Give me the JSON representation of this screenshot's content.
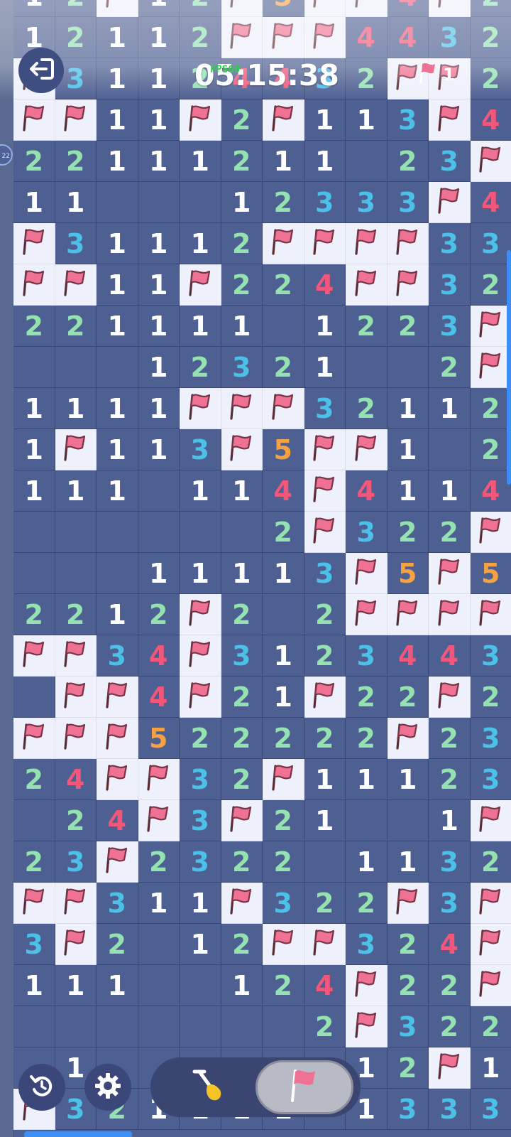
{
  "hud": {
    "timer": "05:15:38",
    "fps_overlay": "FPS60",
    "flags_remaining": "1",
    "side_bubble_text": "22"
  },
  "icons": {
    "exit": "exit-arrow-icon",
    "flag": "flag-icon",
    "undo": "undo-icon",
    "settings": "gear-icon",
    "dig": "shovel-icon"
  },
  "colors": {
    "background": "#4e5f91",
    "flag_cell": "#eef0fb",
    "flag": "#ef7193",
    "n1": "#ffffff",
    "n2": "#93e2b0",
    "n3": "#4bc1ea",
    "n4": "#f0577a",
    "n5": "#f6a142",
    "accent": "#3d8df5"
  },
  "toolbar": {
    "selected_tool": "flag"
  },
  "legend": {
    "F": "flagged cell",
    "0": "revealed empty cell",
    "1-5": "adjacent mine count"
  },
  "board": {
    "columns": 12,
    "rows": [
      [
        "1",
        "2",
        "F",
        "1",
        "2",
        "F",
        "5",
        "F",
        "F",
        "4",
        "F",
        "2"
      ],
      [
        "1",
        "2",
        "1",
        "1",
        "2",
        "F",
        "F",
        "F",
        "4",
        "4",
        "3",
        "2"
      ],
      [
        "F",
        "3",
        "1",
        "1",
        "2",
        "4",
        "4",
        "3",
        "2",
        "F",
        "F",
        "2"
      ],
      [
        "F",
        "F",
        "1",
        "1",
        "F",
        "2",
        "F",
        "1",
        "1",
        "3",
        "F",
        "4"
      ],
      [
        "2",
        "2",
        "1",
        "1",
        "1",
        "2",
        "1",
        "1",
        "0",
        "2",
        "3",
        "F"
      ],
      [
        "1",
        "1",
        "0",
        "0",
        "0",
        "1",
        "2",
        "3",
        "3",
        "3",
        "F",
        "4"
      ],
      [
        "F",
        "3",
        "1",
        "1",
        "1",
        "2",
        "F",
        "F",
        "F",
        "F",
        "3",
        "3"
      ],
      [
        "F",
        "F",
        "1",
        "1",
        "F",
        "2",
        "2",
        "4",
        "F",
        "F",
        "3",
        "2"
      ],
      [
        "2",
        "2",
        "1",
        "1",
        "1",
        "1",
        "0",
        "1",
        "2",
        "2",
        "3",
        "F"
      ],
      [
        "0",
        "0",
        "0",
        "1",
        "2",
        "3",
        "2",
        "1",
        "0",
        "0",
        "2",
        "F"
      ],
      [
        "1",
        "1",
        "1",
        "1",
        "F",
        "F",
        "F",
        "3",
        "2",
        "1",
        "1",
        "2"
      ],
      [
        "1",
        "F",
        "1",
        "1",
        "3",
        "F",
        "5",
        "F",
        "F",
        "1",
        "0",
        "2"
      ],
      [
        "1",
        "1",
        "1",
        "0",
        "1",
        "1",
        "4",
        "F",
        "4",
        "1",
        "1",
        "4"
      ],
      [
        "0",
        "0",
        "0",
        "0",
        "0",
        "0",
        "2",
        "F",
        "3",
        "2",
        "2",
        "F"
      ],
      [
        "0",
        "0",
        "0",
        "1",
        "1",
        "1",
        "1",
        "3",
        "F",
        "5",
        "F",
        "5"
      ],
      [
        "2",
        "2",
        "1",
        "2",
        "F",
        "2",
        "0",
        "2",
        "F",
        "F",
        "F",
        "F"
      ],
      [
        "F",
        "F",
        "3",
        "4",
        "F",
        "3",
        "1",
        "2",
        "3",
        "4",
        "4",
        "3"
      ],
      [
        "0",
        "F",
        "F",
        "4",
        "F",
        "2",
        "1",
        "F",
        "2",
        "2",
        "F",
        "2"
      ],
      [
        "F",
        "F",
        "F",
        "5",
        "2",
        "2",
        "2",
        "2",
        "2",
        "F",
        "2",
        "3"
      ],
      [
        "2",
        "4",
        "F",
        "F",
        "3",
        "2",
        "F",
        "1",
        "1",
        "1",
        "2",
        "3"
      ],
      [
        "0",
        "2",
        "4",
        "F",
        "3",
        "F",
        "2",
        "1",
        "0",
        "0",
        "1",
        "F"
      ],
      [
        "2",
        "3",
        "F",
        "2",
        "3",
        "2",
        "2",
        "0",
        "1",
        "1",
        "3",
        "2"
      ],
      [
        "F",
        "F",
        "3",
        "1",
        "1",
        "F",
        "3",
        "2",
        "2",
        "F",
        "3",
        "F"
      ],
      [
        "3",
        "F",
        "2",
        "0",
        "1",
        "2",
        "F",
        "F",
        "3",
        "2",
        "4",
        "F"
      ],
      [
        "1",
        "1",
        "1",
        "0",
        "0",
        "1",
        "2",
        "4",
        "F",
        "2",
        "2",
        "F"
      ],
      [
        "0",
        "0",
        "0",
        "0",
        "0",
        "0",
        "0",
        "2",
        "F",
        "3",
        "2",
        "2"
      ],
      [
        "0",
        "1",
        "0",
        "0",
        "0",
        "0",
        "0",
        "0",
        "1",
        "2",
        "F",
        "1"
      ],
      [
        "F",
        "3",
        "2",
        "1",
        "1",
        "1",
        "1",
        "0",
        "1",
        "3",
        "3",
        "3"
      ]
    ]
  }
}
